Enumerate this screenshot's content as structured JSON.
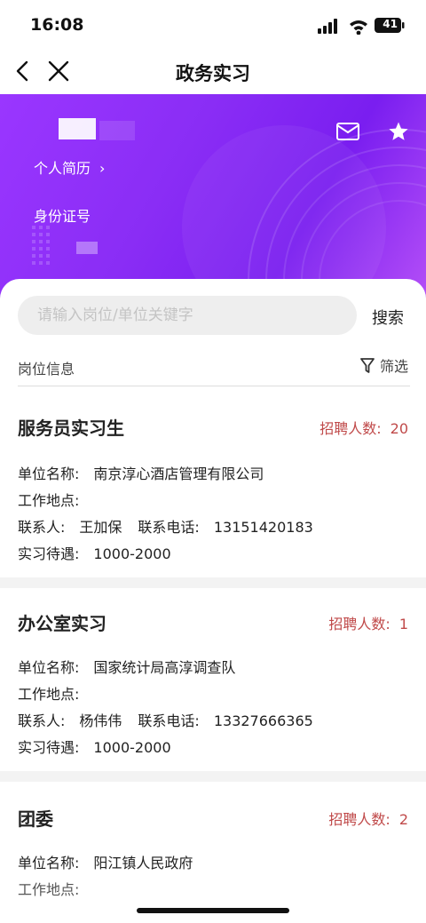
{
  "status_bar": {
    "time": "16:08",
    "battery": "41"
  },
  "nav": {
    "title": "政务实习"
  },
  "hero": {
    "resume_link": "个人简历",
    "id_label": "身份证号"
  },
  "search": {
    "placeholder": "请输入岗位/单位关键字",
    "button": "搜索"
  },
  "section": {
    "title": "岗位信息",
    "filter": "筛选"
  },
  "labels": {
    "company": "单位名称:",
    "location": "工作地点:",
    "contact": "联系人:",
    "phone": "联系电话:",
    "salary": "实习待遇:",
    "hire_count": "招聘人数:"
  },
  "jobs": [
    {
      "title": "服务员实习生",
      "hire_count": "20",
      "company": "南京淳心酒店管理有限公司",
      "location": "",
      "contact": "王加保",
      "phone": "13151420183",
      "salary": "1000-2000"
    },
    {
      "title": "办公室实习",
      "hire_count": "1",
      "company": "国家统计局高淳调查队",
      "location": "",
      "contact": "杨伟伟",
      "phone": "13327666365",
      "salary": "1000-2000"
    },
    {
      "title": "团委",
      "hire_count": "2",
      "company": "阳江镇人民政府",
      "location": ""
    }
  ],
  "colors": {
    "accent": "#c04a4a",
    "hero_start": "#9a36ff",
    "hero_end": "#7a1ef0"
  }
}
